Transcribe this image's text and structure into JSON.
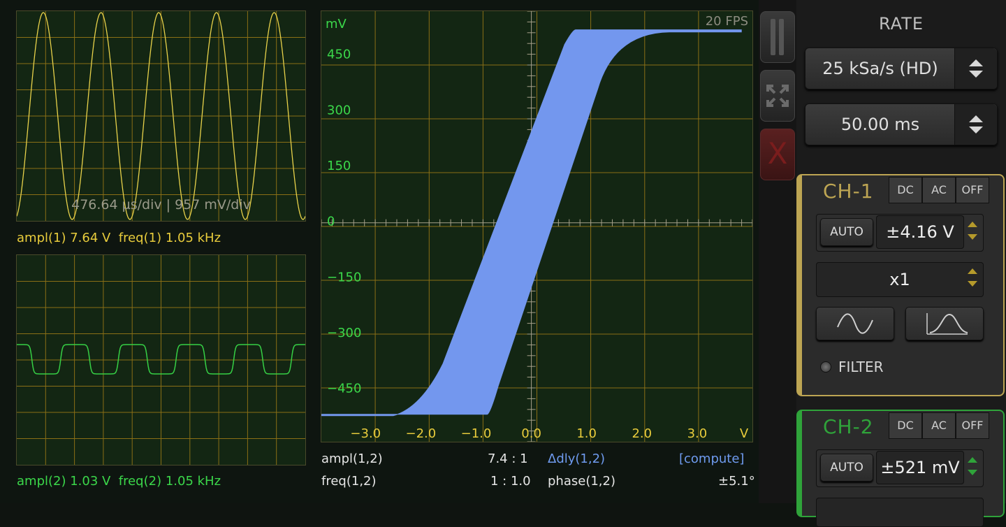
{
  "chart_data": [
    {
      "type": "line",
      "title": "",
      "annotation": "476.64 µs/div | 957 mV/div",
      "series": [
        {
          "name": "CH-1",
          "waveform": "sine",
          "cycles_visible": 5,
          "color": "#e8d24a"
        }
      ],
      "xlim": [
        0,
        10
      ],
      "ylim": [
        -4,
        4
      ],
      "grid": true
    },
    {
      "type": "line",
      "title": "",
      "series": [
        {
          "name": "CH-2",
          "waveform": "rounded-square",
          "cycles_visible": 5,
          "color": "#36d045"
        }
      ],
      "xlim": [
        0,
        10
      ],
      "ylim": [
        -4,
        4
      ],
      "grid": true
    },
    {
      "type": "scatter",
      "title": "",
      "ylabel": "mV",
      "xlabel": "V",
      "x_ticks": [
        "-3.0",
        "-2.0",
        "-1.0",
        "0.0",
        "1.0",
        "2.0",
        "3.0"
      ],
      "y_ticks": [
        "450",
        "300",
        "150",
        "0",
        "-150",
        "-300",
        "-450"
      ],
      "xlim": [
        -3.8,
        4.0
      ],
      "ylim": [
        -590,
        570
      ],
      "series": [
        {
          "name": "XY",
          "shape": "saturation-hysteresis",
          "saturation_mV": [
            -520,
            520
          ],
          "band_left_V": [
            -2.5,
            -0.8
          ],
          "band_right_V": [
            0.8,
            2.5
          ],
          "x_range_V": [
            -3.8,
            3.8
          ],
          "color": "#7397ee"
        }
      ],
      "grid": true
    }
  ],
  "scope": {
    "fps": "20 FPS",
    "ch1_info": "ampl(1) 7.64 V  freq(1) 1.05 kHz",
    "ch2_info": "ampl(2) 1.03 V  freq(2) 1.05 kHz",
    "xy_unit_y": "mV",
    "xy_unit_x": "V",
    "ampl12_label": "ampl(1,2)",
    "ampl12_value": "7.4 : 1",
    "freq12_label": "freq(1,2)",
    "freq12_value": "1 : 1.0",
    "dly_label": "Δdly(1,2)",
    "dly_value": "[compute]",
    "phase_label": "phase(1,2)",
    "phase_value": "±5.1°"
  },
  "sidebar": {
    "close_label": "X"
  },
  "rate": {
    "title": "RATE",
    "sample_rate": "25 kSa/s (HD)",
    "time_window": "50.00 ms"
  },
  "ch1": {
    "title": "CH-1",
    "color": "#bda553",
    "coupling": [
      "DC",
      "AC",
      "OFF"
    ],
    "auto_label": "AUTO",
    "range": "±4.16 V",
    "probe": "x1",
    "filter_label": "FILTER"
  },
  "ch2": {
    "title": "CH-2",
    "color": "#2fa33a",
    "coupling": [
      "DC",
      "AC",
      "OFF"
    ],
    "auto_label": "AUTO",
    "range": "±521 mV"
  }
}
